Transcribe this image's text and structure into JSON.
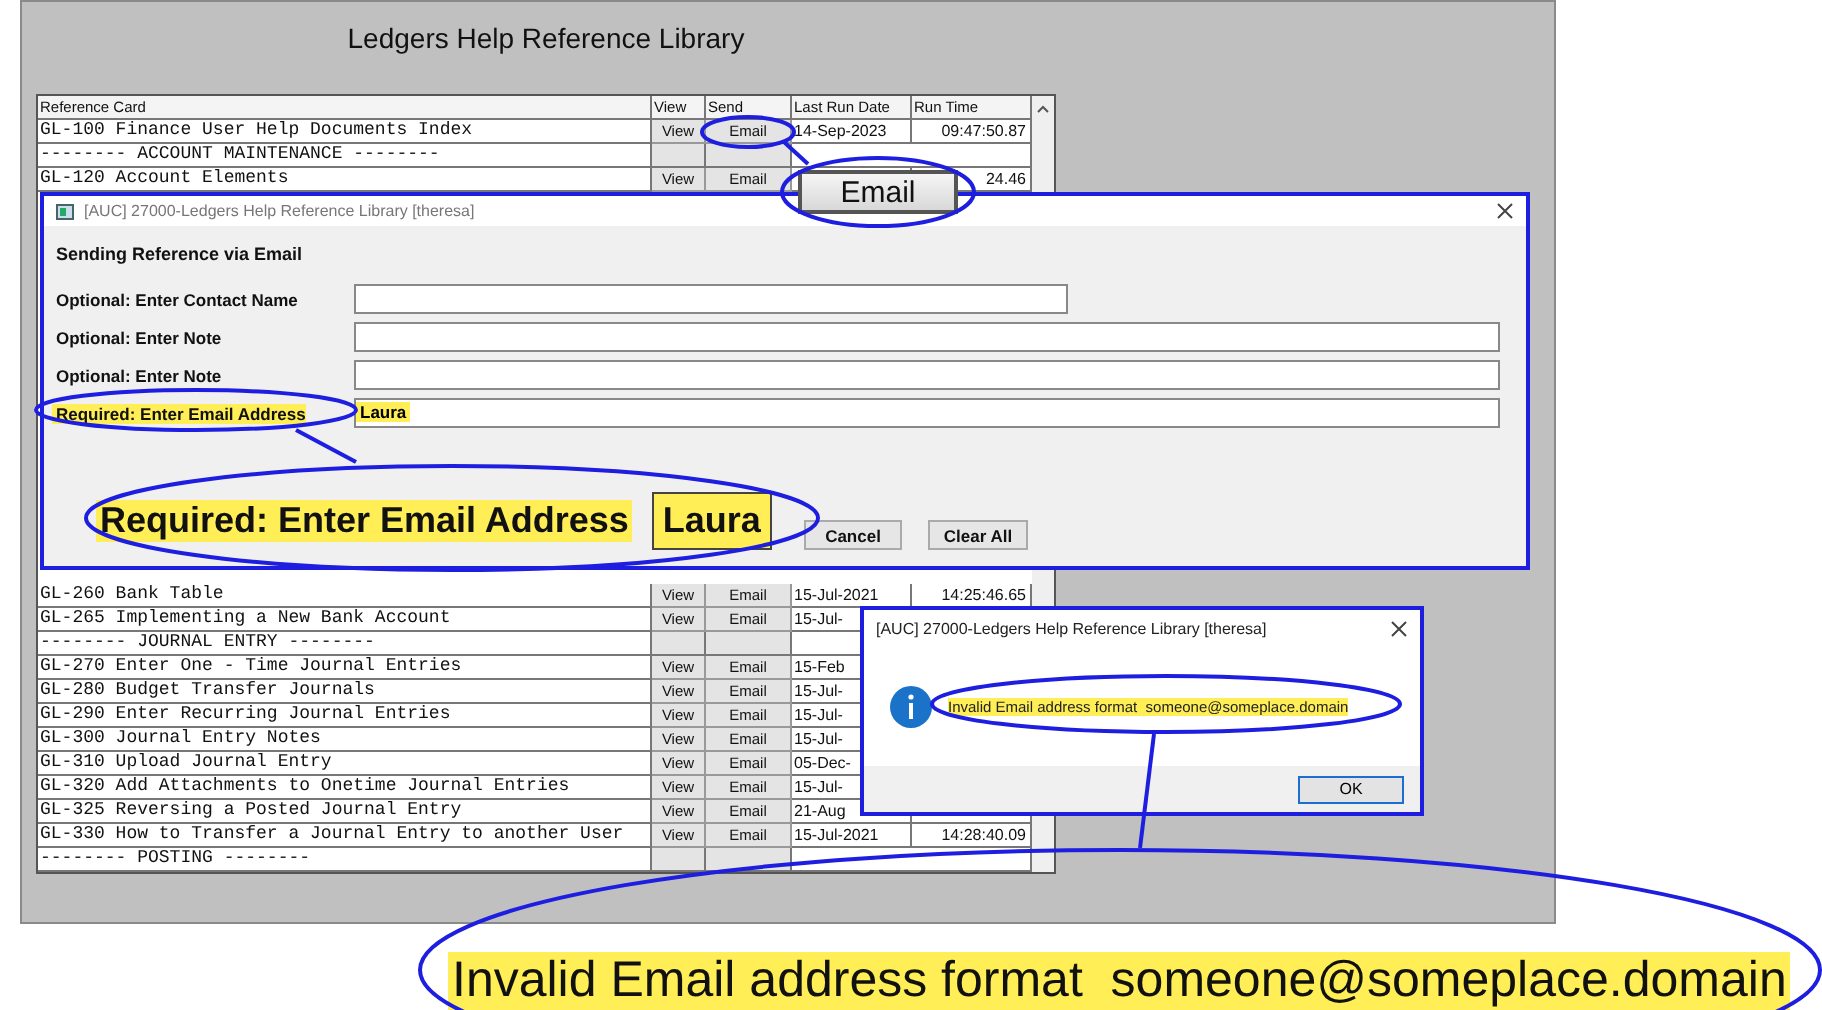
{
  "window": {
    "title": "Ledgers Help Reference Library"
  },
  "table": {
    "columns": [
      "Reference Card",
      "View",
      "Send",
      "Last Run Date",
      "Run Time"
    ],
    "rows_top": [
      {
        "kind": "item",
        "reference_card": "GL-100 Finance User Help Documents Index",
        "view": "View",
        "send": "Email",
        "last_run_date": "14-Sep-2023",
        "run_time": "09:47:50.87"
      },
      {
        "kind": "section",
        "reference_card": "-------- ACCOUNT MAINTENANCE --------"
      },
      {
        "kind": "item",
        "reference_card": "GL-120 Account Elements",
        "view": "View",
        "send": "Email",
        "run_time": "24.46"
      }
    ],
    "rows_bottom": [
      {
        "kind": "item",
        "reference_card": "GL-260 Bank Table",
        "view": "View",
        "send": "Email",
        "last_run_date": "15-Jul-2021",
        "run_time": "14:25:46.65"
      },
      {
        "kind": "item",
        "reference_card": "GL-265 Implementing a New Bank Account",
        "view": "View",
        "send": "Email",
        "last_run_date": "15-Jul-"
      },
      {
        "kind": "section",
        "reference_card": "-------- JOURNAL ENTRY --------"
      },
      {
        "kind": "item",
        "reference_card": "GL-270 Enter One - Time Journal Entries",
        "view": "View",
        "send": "Email",
        "last_run_date": "15-Feb"
      },
      {
        "kind": "item",
        "reference_card": "GL-280 Budget Transfer Journals",
        "view": "View",
        "send": "Email",
        "last_run_date": "15-Jul-"
      },
      {
        "kind": "item",
        "reference_card": "GL-290 Enter Recurring Journal Entries",
        "view": "View",
        "send": "Email",
        "last_run_date": "15-Jul-"
      },
      {
        "kind": "item",
        "reference_card": "GL-300 Journal Entry Notes",
        "view": "View",
        "send": "Email",
        "last_run_date": "15-Jul-"
      },
      {
        "kind": "item",
        "reference_card": "GL-310 Upload Journal Entry",
        "view": "View",
        "send": "Email",
        "last_run_date": "05-Dec-"
      },
      {
        "kind": "item",
        "reference_card": "GL-320 Add Attachments to Onetime Journal Entries",
        "view": "View",
        "send": "Email",
        "last_run_date": "15-Jul-"
      },
      {
        "kind": "item",
        "reference_card": "GL-325 Reversing a Posted Journal Entry",
        "view": "View",
        "send": "Email",
        "last_run_date": "21-Aug"
      },
      {
        "kind": "item",
        "reference_card": "GL-330 How to Transfer a Journal Entry to another User",
        "view": "View",
        "send": "Email",
        "last_run_date": "15-Jul-2021",
        "run_time": "14:28:40.09"
      },
      {
        "kind": "section",
        "reference_card": "-------- POSTING --------"
      }
    ]
  },
  "email_dialog": {
    "title": "[AUC] 27000-Ledgers Help Reference Library [theresa]",
    "heading": "Sending Reference via Email",
    "fields": [
      {
        "kind": "short",
        "label": "Optional: Enter Contact Name",
        "highlighted": false
      },
      {
        "kind": "long",
        "label": "Optional: Enter Note",
        "highlighted": false
      },
      {
        "kind": "long",
        "label": "Optional: Enter Note",
        "highlighted": false
      },
      {
        "kind": "long",
        "label": "Required: Enter Email Address",
        "value": "Laura",
        "highlighted": true
      }
    ],
    "buttons": [
      "Cancel",
      "Clear All"
    ]
  },
  "error_dialog": {
    "title": "[AUC] 27000-Ledgers Help Reference Library [theresa]",
    "message": "Invalid Email address format  someone@someplace.domain",
    "buttons": [
      "OK"
    ]
  },
  "zoom_callouts": [
    {
      "kind": "button",
      "text": "Email"
    },
    {
      "kind": "field",
      "label": "Required: Enter Email Address",
      "value": "Laura"
    },
    {
      "kind": "message",
      "text": "Invalid Email address format  someone@someplace.domain"
    }
  ]
}
